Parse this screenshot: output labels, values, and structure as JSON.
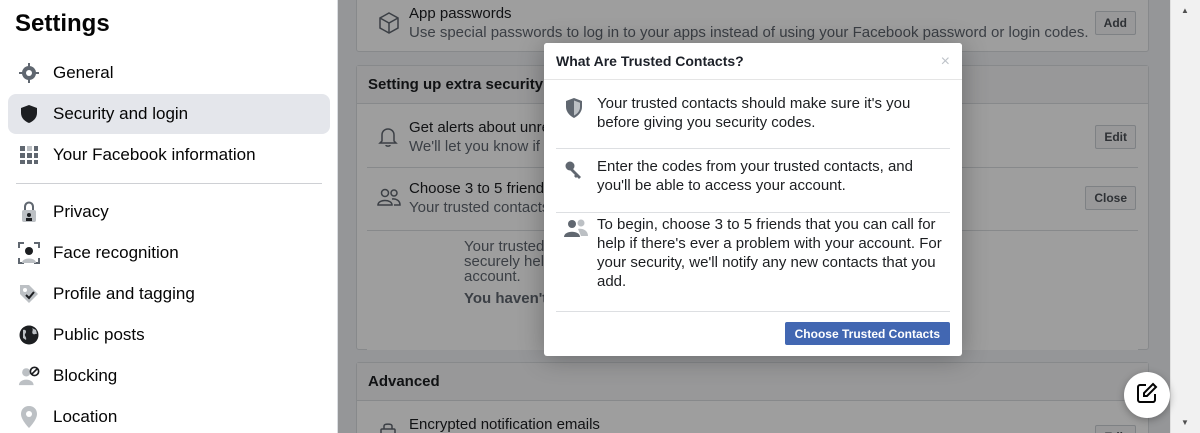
{
  "sidebar": {
    "title": "Settings",
    "items": [
      {
        "label": "General",
        "icon": "gear-icon"
      },
      {
        "label": "Security and login",
        "icon": "shield-icon"
      },
      {
        "label": "Your Facebook information",
        "icon": "grid-icon"
      },
      {
        "label": "Privacy",
        "icon": "lock-person-icon"
      },
      {
        "label": "Face recognition",
        "icon": "face-scan-icon"
      },
      {
        "label": "Profile and tagging",
        "icon": "tag-icon"
      },
      {
        "label": "Public posts",
        "icon": "globe-icon"
      },
      {
        "label": "Blocking",
        "icon": "block-person-icon"
      },
      {
        "label": "Location",
        "icon": "location-pin-icon"
      }
    ]
  },
  "main": {
    "app_passwords": {
      "title": "App passwords",
      "subtitle": "Use special passwords to log in to your apps instead of using your Facebook password or login codes.",
      "button": "Add"
    },
    "extra_security": {
      "heading": "Setting up extra security",
      "alerts_title": "Get alerts about unrec",
      "alerts_sub": "We'll let you know if a",
      "alerts_button": "Edit",
      "friends_title": "Choose 3 to 5 friends",
      "friends_sub": "Your trusted contacts",
      "friends_button": "Close",
      "expanded_line1": "Your trusted",
      "expanded_line2": "securely help",
      "expanded_line3": "account.",
      "expanded_bold": "You haven't"
    },
    "advanced": {
      "heading": "Advanced",
      "encrypted_title": "Encrypted notification emails",
      "encrypted_button": "Edit"
    }
  },
  "modal": {
    "title": "What Are Trusted Contacts?",
    "close": "×",
    "items": [
      {
        "icon": "shield-icon",
        "text": "Your trusted contacts should make sure it's you before giving you security codes."
      },
      {
        "icon": "key-icon",
        "text": "Enter the codes from your trusted contacts, and you'll be able to access your account."
      },
      {
        "icon": "people-icon",
        "text": "To begin, choose 3 to 5 friends that you can call for help if there's ever a problem with your account. For your security, we'll notify any new contacts that you add."
      }
    ],
    "button": "Choose Trusted Contacts"
  },
  "colors": {
    "brand_blue": "#4267b2",
    "overlay": "rgba(0,0,0,0.38)",
    "sidebar_active": "#e4e6eb"
  }
}
